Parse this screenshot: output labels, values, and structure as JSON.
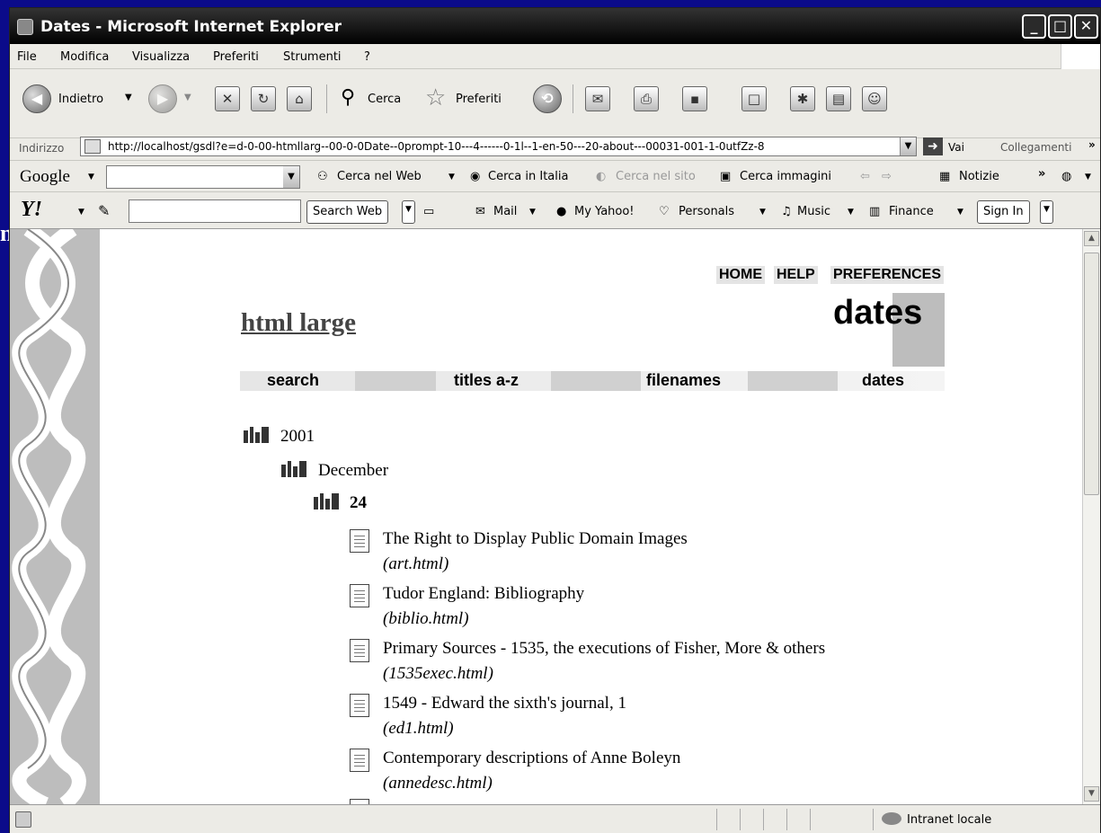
{
  "background_fragment": "n",
  "window": {
    "title": "Dates - Microsoft Internet Explorer"
  },
  "menubar": [
    "File",
    "Modifica",
    "Visualizza",
    "Preferiti",
    "Strumenti",
    "?"
  ],
  "toolbar": {
    "back": "Indietro",
    "search": "Cerca",
    "favorites": "Preferiti"
  },
  "address": {
    "label": "Indirizzo",
    "url": "http://localhost/gsdl?e=d-0-00-htmllarg--00-0-0Date--0prompt-10---4------0-1l--1-en-50---20-about---00031-001-1-0utfZz-8",
    "go": "Vai",
    "links": "Collegamenti"
  },
  "google": {
    "logo": "Google",
    "search_web": "Cerca nel Web",
    "search_italy": "Cerca in Italia",
    "search_site": "Cerca nel sito",
    "search_images": "Cerca immagini",
    "news": "Notizie"
  },
  "yahoo": {
    "logo": "Y!",
    "search_web": "Search Web",
    "mail": "Mail",
    "my_yahoo": "My Yahoo!",
    "personals": "Personals",
    "music": "Music",
    "finance": "Finance",
    "sign_in": "Sign In"
  },
  "page": {
    "top_nav": [
      "HOME",
      "HELP",
      "PREFERENCES"
    ],
    "collection_title": "html large",
    "section_heading": "dates",
    "nav": [
      "search",
      "titles a-z",
      "filenames",
      "dates"
    ],
    "tree": {
      "year": "2001",
      "month": "December",
      "day": "24",
      "documents": [
        {
          "title": "The Right to Display Public Domain Images",
          "file": "(art.html)"
        },
        {
          "title": "Tudor England: Bibliography",
          "file": "(biblio.html)"
        },
        {
          "title": "Primary Sources - 1535, the executions of Fisher, More & others",
          "file": "(1535exec.html)"
        },
        {
          "title": "1549 - Edward the sixth's journal, 1",
          "file": "(ed1.html)"
        },
        {
          "title": "Contemporary descriptions of Anne Boleyn",
          "file": "(annedesc.html)"
        }
      ]
    }
  },
  "status": {
    "zone": "Intranet locale"
  }
}
